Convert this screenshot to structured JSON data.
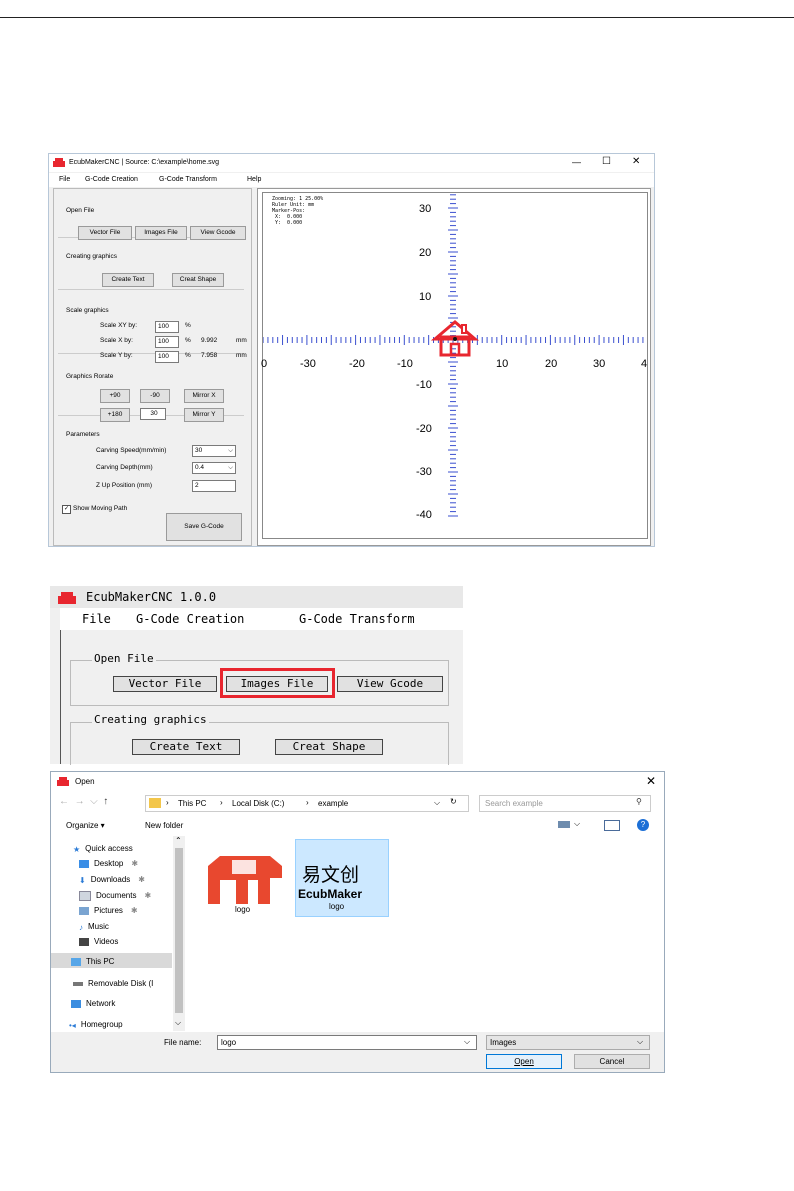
{
  "window1": {
    "title": "EcubMakerCNC | Source: C:\\example\\home.svg",
    "menu": [
      "File",
      "G-Code Creation",
      "G-Code Transform",
      "Help"
    ],
    "controls": {
      "minimize": "—",
      "maximize": "☐",
      "close": "✕"
    },
    "open_file": {
      "heading": "Open File",
      "vector": "Vector File",
      "images": "Images File",
      "view": "View Gcode"
    },
    "creating": {
      "heading": "Creating graphics",
      "text": "Create Text",
      "shape": "Creat Shape"
    },
    "scale": {
      "heading": "Scale graphics",
      "xy_label": "Scale XY by:",
      "xy_value": "100",
      "xy_unit": "%",
      "x_label": "Scale X by:",
      "x_value": "100",
      "x_unit": "%",
      "x_mm": "9.992",
      "x_mm_unit": "mm",
      "y_label": "Scale Y by:",
      "y_value": "100",
      "y_unit": "%",
      "y_mm": "7.958",
      "y_mm_unit": "mm"
    },
    "rotate": {
      "heading": "Graphics Rorate",
      "p90": "+90",
      "m90": "-90",
      "mirror_x": "Mirror X",
      "p180": "+180",
      "angle": "30",
      "mirror_y": "Mirror Y"
    },
    "params": {
      "heading": "Parameters",
      "speed_label": "Carving Speed(mm/min)",
      "speed_value": "30",
      "depth_label": "Carving Depth(mm)",
      "depth_value": "0.4",
      "z_label": "Z Up Position (mm)",
      "z_value": "2"
    },
    "show_path": "Show Moving Path",
    "save": "Save G-Code",
    "info": {
      "zooming": "Zooming:   1 25.00%",
      "ruler": "Ruler Unit: mm",
      "marker": "Marker-Pos:",
      "x": " X:  0.000",
      "y": " Y:  0.000"
    },
    "x_ticks": [
      "0",
      "-30",
      "-20",
      "-10",
      "10",
      "20",
      "30",
      "4"
    ],
    "y_ticks": [
      "30",
      "20",
      "10",
      "-10",
      "-20",
      "-30",
      "-40"
    ]
  },
  "window2": {
    "title": "EcubMakerCNC 1.0.0",
    "menu": [
      "File",
      "G-Code Creation",
      "G-Code Transform"
    ],
    "open_file": {
      "heading": "Open File",
      "vector": "Vector File",
      "images": "Images File",
      "view": "View Gcode"
    },
    "creating": {
      "heading": "Creating graphics",
      "text": "Create Text",
      "shape": "Creat Shape"
    },
    "highlight_color": "#e8262f"
  },
  "window3": {
    "title": "Open",
    "breadcrumb": [
      "This PC",
      "Local Disk (C:)",
      "example"
    ],
    "search_placeholder": "Search example",
    "organize": "Organize ▾",
    "new_folder": "New folder",
    "nav": [
      "Quick access",
      "Desktop",
      "Downloads",
      "Documents",
      "Pictures",
      "Music",
      "Videos",
      "This PC",
      "Removable Disk (I",
      "Network",
      "Homegroup"
    ],
    "files": [
      {
        "name": "logo"
      },
      {
        "name": "logo",
        "brand_text": "EcubMaker",
        "chinese": "易文创"
      }
    ],
    "filename_label": "File name:",
    "filename_value": "logo",
    "filter": "Images",
    "open_btn": "Open",
    "cancel_btn": "Cancel"
  },
  "colors": {
    "brand_red": "#e8262f",
    "ruler_blue": "#3a4fcf",
    "selected": "#cce8ff"
  }
}
